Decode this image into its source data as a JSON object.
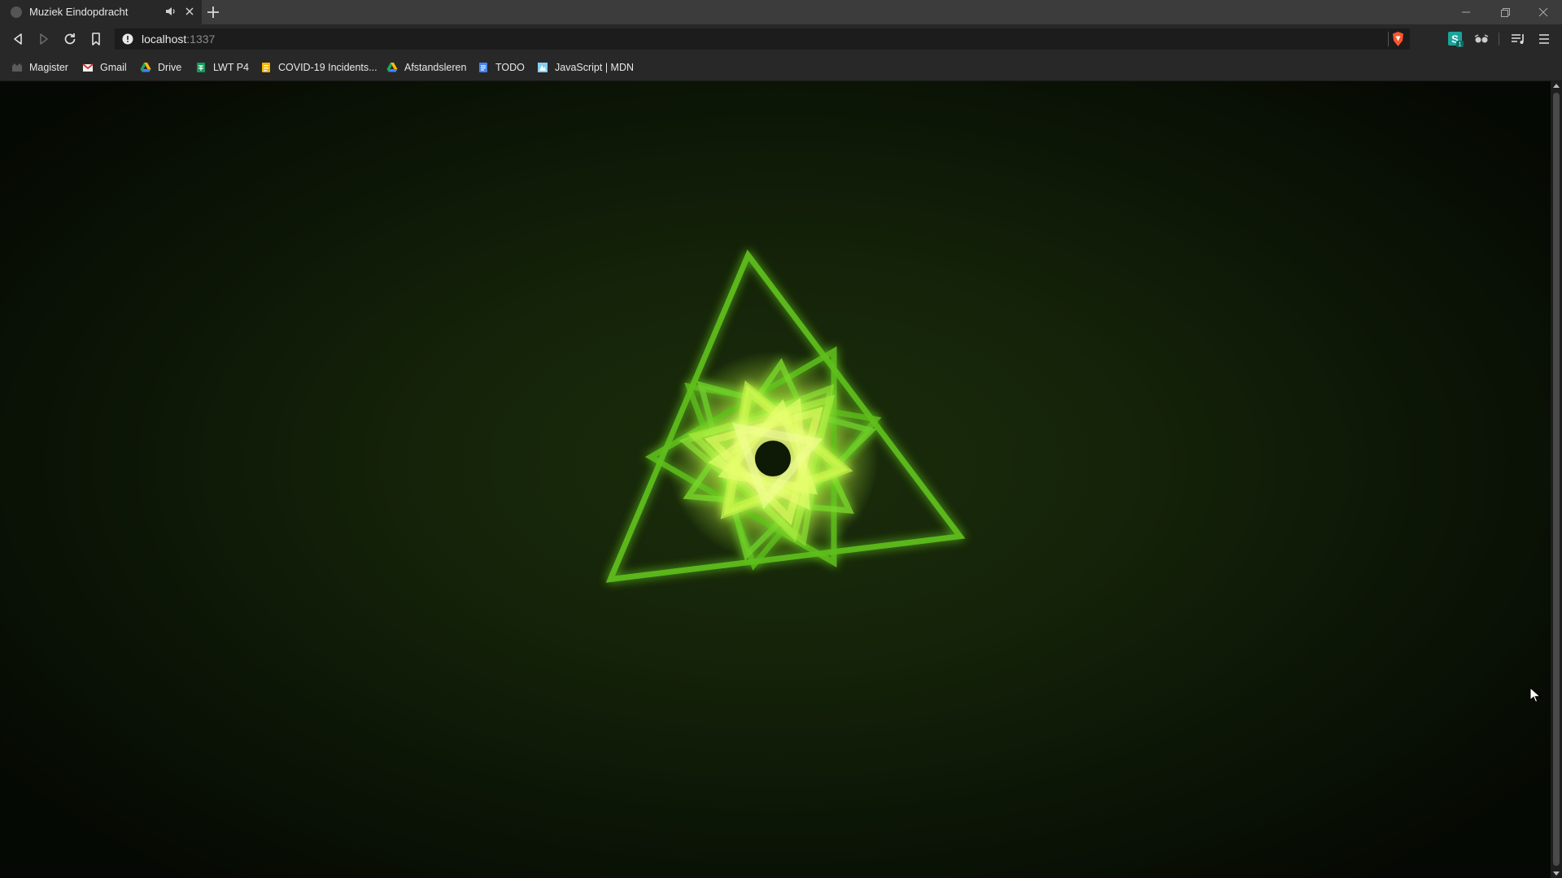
{
  "tab": {
    "title": "Muziek Eindopdracht",
    "audio_icon": "speaker-icon",
    "close_icon": "close-icon"
  },
  "toolbar": {
    "url_host": "localhost",
    "url_port": ":1337",
    "back_icon": "back-arrow-icon",
    "forward_icon": "forward-arrow-icon",
    "reload_icon": "reload-icon",
    "bookmark_icon": "bookmark-icon"
  },
  "bookmarks": [
    {
      "label": "Magister",
      "icon": "magister-icon",
      "color": "#5a5a5a"
    },
    {
      "label": "Gmail",
      "icon": "gmail-icon",
      "color": "#d93025"
    },
    {
      "label": "Drive",
      "icon": "drive-icon",
      "color": "#1fa463"
    },
    {
      "label": "LWT P4",
      "icon": "sheets-icon",
      "color": "#0f9d58"
    },
    {
      "label": "COVID-19 Incidents...",
      "icon": "forms-icon",
      "color": "#f4b400"
    },
    {
      "label": "Afstandsleren",
      "icon": "drive-icon",
      "color": "#1fa463"
    },
    {
      "label": "TODO",
      "icon": "docs-icon",
      "color": "#4285f4"
    },
    {
      "label": "JavaScript | MDN",
      "icon": "mdn-icon",
      "color": "#83d0f2"
    }
  ],
  "visualizer": {
    "stroke_color": "#5fbf1f",
    "glow_color": "#e8ff70",
    "background": "#132208"
  }
}
